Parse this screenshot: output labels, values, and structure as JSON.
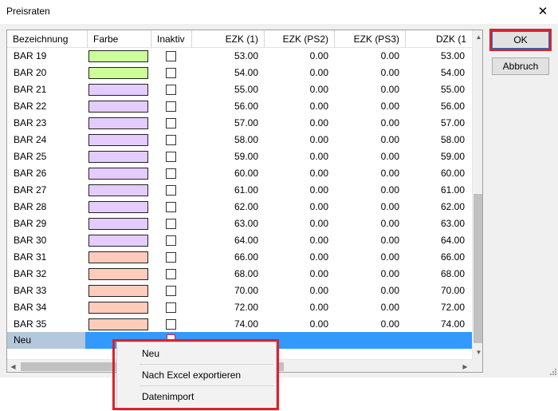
{
  "window": {
    "title": "Preisraten",
    "close_symbol": "✕"
  },
  "columns": [
    {
      "label": "Bezeichnung"
    },
    {
      "label": "Farbe"
    },
    {
      "label": "Inaktiv"
    },
    {
      "label": "EZK (1)"
    },
    {
      "label": "EZK (PS2)"
    },
    {
      "label": "EZK (PS3)"
    },
    {
      "label": "DZK (1"
    }
  ],
  "rows": [
    {
      "name": "BAR 19",
      "color": "#ccff99",
      "inactive": false,
      "ezk1": "53.00",
      "ezk_ps2": "0.00",
      "ezk_ps3": "0.00",
      "dzk1": "53.00"
    },
    {
      "name": "BAR 20",
      "color": "#ccff99",
      "inactive": false,
      "ezk1": "54.00",
      "ezk_ps2": "0.00",
      "ezk_ps3": "0.00",
      "dzk1": "54.00"
    },
    {
      "name": "BAR 21",
      "color": "#e5ccff",
      "inactive": false,
      "ezk1": "55.00",
      "ezk_ps2": "0.00",
      "ezk_ps3": "0.00",
      "dzk1": "55.00"
    },
    {
      "name": "BAR 22",
      "color": "#e5ccff",
      "inactive": false,
      "ezk1": "56.00",
      "ezk_ps2": "0.00",
      "ezk_ps3": "0.00",
      "dzk1": "56.00"
    },
    {
      "name": "BAR 23",
      "color": "#e5ccff",
      "inactive": false,
      "ezk1": "57.00",
      "ezk_ps2": "0.00",
      "ezk_ps3": "0.00",
      "dzk1": "57.00"
    },
    {
      "name": "BAR 24",
      "color": "#e5ccff",
      "inactive": false,
      "ezk1": "58.00",
      "ezk_ps2": "0.00",
      "ezk_ps3": "0.00",
      "dzk1": "58.00"
    },
    {
      "name": "BAR 25",
      "color": "#e5ccff",
      "inactive": false,
      "ezk1": "59.00",
      "ezk_ps2": "0.00",
      "ezk_ps3": "0.00",
      "dzk1": "59.00"
    },
    {
      "name": "BAR 26",
      "color": "#e5ccff",
      "inactive": false,
      "ezk1": "60.00",
      "ezk_ps2": "0.00",
      "ezk_ps3": "0.00",
      "dzk1": "60.00"
    },
    {
      "name": "BAR 27",
      "color": "#e5ccff",
      "inactive": false,
      "ezk1": "61.00",
      "ezk_ps2": "0.00",
      "ezk_ps3": "0.00",
      "dzk1": "61.00"
    },
    {
      "name": "BAR 28",
      "color": "#e5ccff",
      "inactive": false,
      "ezk1": "62.00",
      "ezk_ps2": "0.00",
      "ezk_ps3": "0.00",
      "dzk1": "62.00"
    },
    {
      "name": "BAR 29",
      "color": "#e5ccff",
      "inactive": false,
      "ezk1": "63.00",
      "ezk_ps2": "0.00",
      "ezk_ps3": "0.00",
      "dzk1": "63.00"
    },
    {
      "name": "BAR 30",
      "color": "#e5ccff",
      "inactive": false,
      "ezk1": "64.00",
      "ezk_ps2": "0.00",
      "ezk_ps3": "0.00",
      "dzk1": "64.00"
    },
    {
      "name": "BAR 31",
      "color": "#ffccbb",
      "inactive": false,
      "ezk1": "66.00",
      "ezk_ps2": "0.00",
      "ezk_ps3": "0.00",
      "dzk1": "66.00"
    },
    {
      "name": "BAR 32",
      "color": "#ffccbb",
      "inactive": false,
      "ezk1": "68.00",
      "ezk_ps2": "0.00",
      "ezk_ps3": "0.00",
      "dzk1": "68.00"
    },
    {
      "name": "BAR 33",
      "color": "#ffccbb",
      "inactive": false,
      "ezk1": "70.00",
      "ezk_ps2": "0.00",
      "ezk_ps3": "0.00",
      "dzk1": "70.00"
    },
    {
      "name": "BAR 34",
      "color": "#ffccbb",
      "inactive": false,
      "ezk1": "72.00",
      "ezk_ps2": "0.00",
      "ezk_ps3": "0.00",
      "dzk1": "72.00"
    },
    {
      "name": "BAR 35",
      "color": "#ffccbb",
      "inactive": false,
      "ezk1": "74.00",
      "ezk_ps2": "0.00",
      "ezk_ps3": "0.00",
      "dzk1": "74.00"
    }
  ],
  "new_row": {
    "label": "Neu"
  },
  "buttons": {
    "ok": "OK",
    "cancel": "Abbruch"
  },
  "context_menu": {
    "items": [
      {
        "label": "Neu"
      },
      {
        "label": "Nach Excel exportieren"
      },
      {
        "label": "Datenimport"
      }
    ]
  },
  "scrollbar_icons": {
    "up": "▲",
    "down": "▼",
    "left": "◀",
    "right": "▶"
  },
  "colors": {
    "selection": "#3399ff",
    "highlight_red": "#d9232d",
    "ok_focus_border": "#0078d7"
  }
}
